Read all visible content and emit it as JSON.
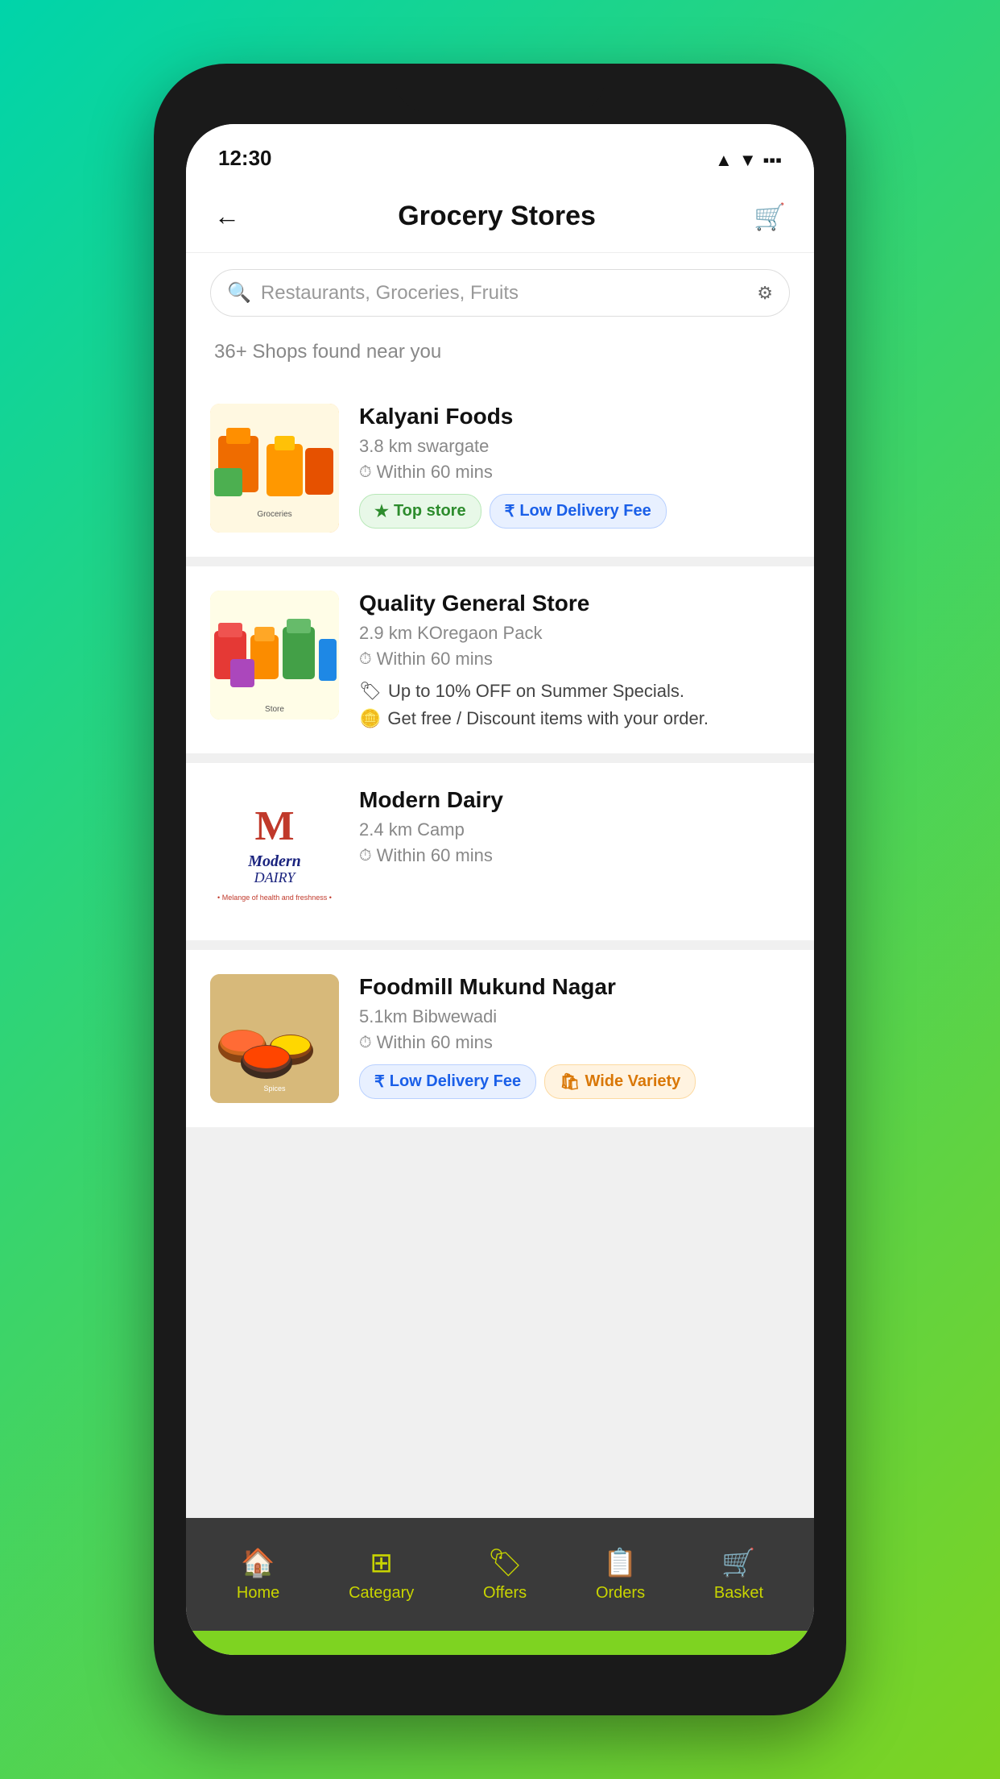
{
  "status_bar": {
    "time": "12:30",
    "signal_icon": "▲",
    "wifi_icon": "▼",
    "battery_icon": "▪"
  },
  "header": {
    "back_label": "←",
    "title": "Grocery Stores",
    "cart_icon": "🛒"
  },
  "search": {
    "placeholder": "Restaurants, Groceries, Fruits",
    "filter_icon": "⚙"
  },
  "results": {
    "text": "36+ Shops found near you"
  },
  "stores": [
    {
      "id": "kalyani",
      "name": "Kalyani Foods",
      "distance": "3.8 km swargate",
      "time": "Within 60 mins",
      "tags": [
        {
          "type": "green",
          "icon": "★",
          "label": "Top store"
        },
        {
          "type": "blue",
          "icon": "₹",
          "label": "Low Delivery Fee"
        }
      ],
      "promos": []
    },
    {
      "id": "quality",
      "name": "Quality General Store",
      "distance": "2.9 km KOregaon Pack",
      "time": "Within 60 mins",
      "tags": [],
      "promos": [
        {
          "icon": "🏷",
          "text": "Up to 10% OFF on Summer Specials."
        },
        {
          "icon": "🪙",
          "text": "Get free / Discount items with your order."
        }
      ]
    },
    {
      "id": "modern",
      "name": "Modern Dairy",
      "distance": "2.4 km Camp",
      "time": "Within 60 mins",
      "tags": [],
      "promos": []
    },
    {
      "id": "foodmill",
      "name": "Foodmill Mukund Nagar",
      "distance": "5.1km Bibwewadi",
      "time": "Within 60 mins",
      "tags": [
        {
          "type": "blue",
          "icon": "₹",
          "label": "Low Delivery Fee"
        },
        {
          "type": "orange",
          "icon": "🛍",
          "label": "Wide Variety"
        }
      ],
      "promos": []
    }
  ],
  "bottom_nav": {
    "items": [
      {
        "id": "home",
        "icon": "🏠",
        "label": "Home"
      },
      {
        "id": "category",
        "icon": "⊞",
        "label": "Categary"
      },
      {
        "id": "offers",
        "icon": "🏷",
        "label": "Offers"
      },
      {
        "id": "orders",
        "icon": "📋",
        "label": "Orders"
      },
      {
        "id": "basket",
        "icon": "🛒",
        "label": "Basket"
      }
    ]
  }
}
